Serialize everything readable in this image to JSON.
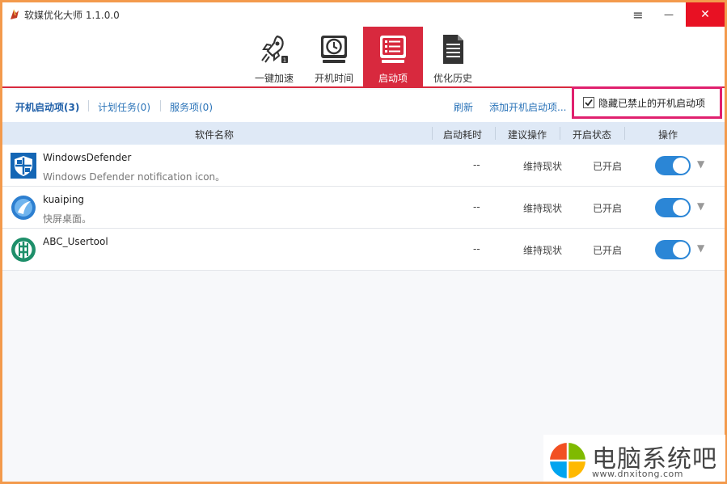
{
  "app": {
    "title": "软媒优化大师 1.1.0.0"
  },
  "window_controls": {
    "menu": "≡",
    "minimize": "—",
    "close": "✕"
  },
  "toolbar": {
    "items": [
      {
        "label": "一键加速",
        "icon": "rocket-icon"
      },
      {
        "label": "开机时间",
        "icon": "clock-icon"
      },
      {
        "label": "启动项",
        "icon": "startup-list-icon",
        "active": true
      },
      {
        "label": "优化历史",
        "icon": "document-icon"
      }
    ]
  },
  "subtabs": {
    "items": [
      "开机启动项(3)",
      "计划任务(0)",
      "服务项(0)"
    ],
    "refresh": "刷新",
    "add": "添加开机启动项...",
    "hide_disabled_label": "隐藏已禁止的开机启动项",
    "hide_disabled_checked": true
  },
  "table": {
    "headers": {
      "name": "软件名称",
      "time": "启动耗时",
      "advice": "建议操作",
      "status": "开启状态",
      "action": "操作"
    },
    "rows": [
      {
        "name": "WindowsDefender",
        "desc": "Windows Defender notification icon。",
        "time": "--",
        "advice": "维持现状",
        "status": "已开启",
        "enabled": true,
        "icon": "shield-icon"
      },
      {
        "name": "kuaiping",
        "desc": "快屏桌面。",
        "time": "--",
        "advice": "维持现状",
        "status": "已开启",
        "enabled": true,
        "icon": "kuaiping-icon"
      },
      {
        "name": "ABC_Usertool",
        "desc": "",
        "time": "--",
        "advice": "维持现状",
        "status": "已开启",
        "enabled": true,
        "icon": "abc-bank-icon"
      }
    ]
  },
  "watermark": {
    "title": "电脑系统吧",
    "url": "www.dnxitong.com"
  },
  "colors": {
    "accent_red": "#d8293e",
    "highlight_pink": "#e0206e",
    "toggle_blue": "#2b86d6",
    "header_bg": "#dfe9f6",
    "frame_orange": "#f39a4c"
  }
}
